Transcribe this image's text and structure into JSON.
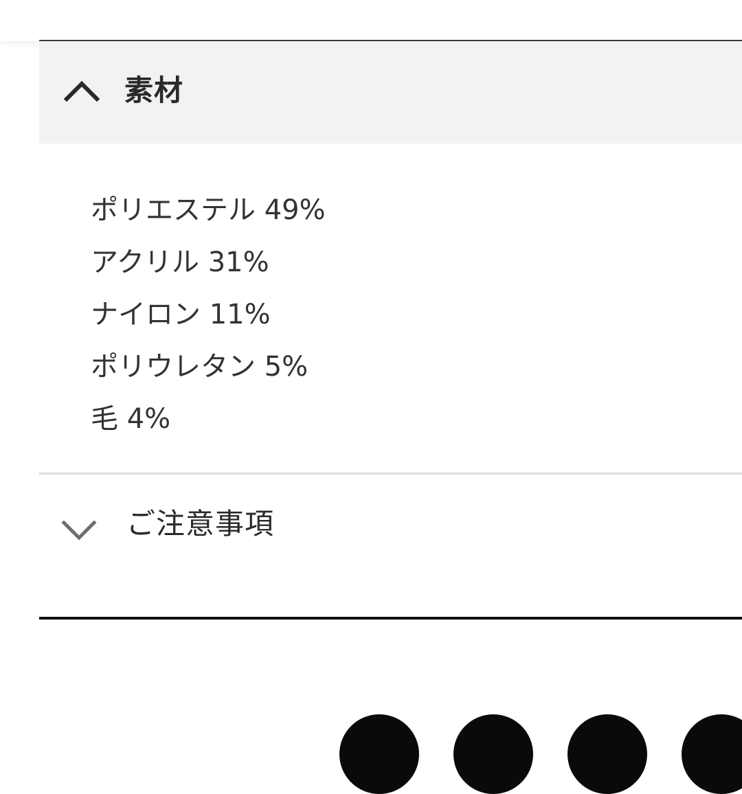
{
  "accordion": {
    "materials": {
      "title": "素材",
      "expanded": true,
      "items": [
        "ポリエステル 49%",
        "アクリル 31%",
        "ナイロン 11%",
        "ポリウレタン 5%",
        "毛 4%"
      ]
    },
    "notes": {
      "title": "ご注意事項",
      "expanded": false
    }
  },
  "icons": {
    "expanded_chevron": "chevron-up-icon",
    "collapsed_chevron": "chevron-down-icon",
    "share": [
      "share-button-icon",
      "share-button-icon",
      "share-button-icon",
      "share-button-icon"
    ]
  },
  "colors": {
    "header_bg": "#f2f2f2",
    "text": "#2a2a2a",
    "divider": "#dcdcdc",
    "rule": "#111111",
    "share_button": "#0a0a0a"
  }
}
